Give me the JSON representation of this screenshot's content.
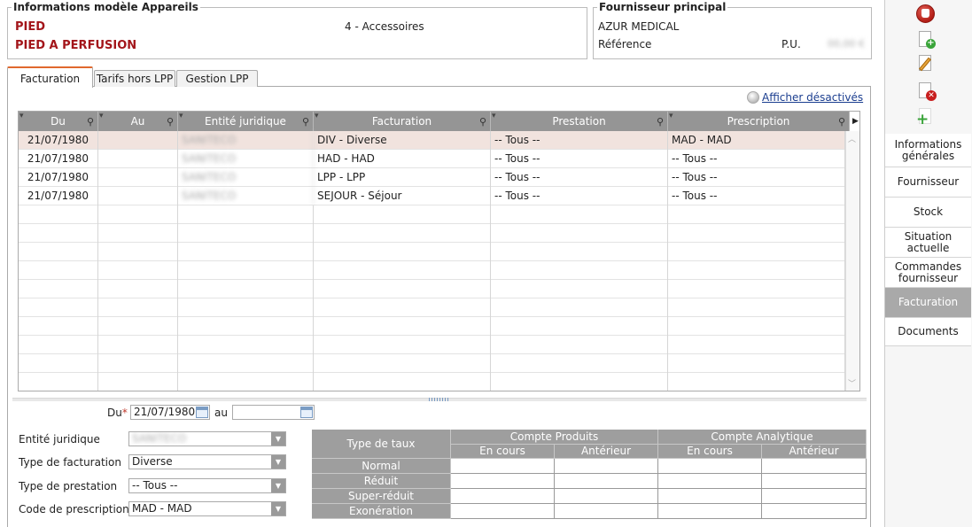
{
  "model_box": {
    "legend": "Informations modèle Appareils",
    "line1": "PIED",
    "line2": "PIED A PERFUSION",
    "category": "4 - Accessoires"
  },
  "supplier_box": {
    "legend": "Fournisseur principal",
    "name": "AZUR MEDICAL",
    "reference_label": "Référence",
    "pu_label": "P.U.",
    "pu_value": "00,00 €"
  },
  "tabs": [
    {
      "label": "Facturation",
      "active": true
    },
    {
      "label": "Tarifs hors LPP",
      "active": false
    },
    {
      "label": "Gestion LPP",
      "active": false
    }
  ],
  "show_disabled_link": "Afficher désactivés",
  "grid": {
    "columns": [
      "Du",
      "Au",
      "Entité juridique",
      "Facturation",
      "Prestation",
      "Prescription"
    ],
    "rows": [
      {
        "du": "21/07/1980",
        "au": "",
        "entite": "SANITECO",
        "facturation": "DIV - Diverse",
        "prestation": "-- Tous --",
        "prescription": "MAD - MAD"
      },
      {
        "du": "21/07/1980",
        "au": "",
        "entite": "SANITECO",
        "facturation": "HAD - HAD",
        "prestation": "-- Tous --",
        "prescription": "-- Tous --"
      },
      {
        "du": "21/07/1980",
        "au": "",
        "entite": "SANITECO",
        "facturation": "LPP - LPP",
        "prestation": "-- Tous --",
        "prescription": "-- Tous --"
      },
      {
        "du": "21/07/1980",
        "au": "",
        "entite": "SANITECO",
        "facturation": "SEJOUR - Séjour",
        "prestation": "-- Tous --",
        "prescription": "-- Tous --"
      }
    ]
  },
  "form": {
    "du_label": "Du",
    "required_mark": "*",
    "du_value": "21/07/1980",
    "au_label": "au",
    "au_value": "",
    "entite_label": "Entité juridique",
    "entite_value": "SANITECO",
    "type_fact_label": "Type de facturation",
    "type_fact_value": "Diverse",
    "type_prest_label": "Type de prestation",
    "type_prest_value": "-- Tous --",
    "code_presc_label": "Code de prescription",
    "code_presc_value": "MAD - MAD"
  },
  "rates": {
    "type_header": "Type de taux",
    "group1": "Compte Produits",
    "group2": "Compte Analytique",
    "sub": [
      "En cours",
      "Antérieur",
      "En cours",
      "Antérieur"
    ],
    "rows": [
      "Normal",
      "Réduit",
      "Super-réduit",
      "Exonération"
    ]
  },
  "side_menu": [
    {
      "label": "Informations générales",
      "active": false
    },
    {
      "label": "Fournisseur",
      "active": false
    },
    {
      "label": "Stock",
      "active": false
    },
    {
      "label": "Situation actuelle",
      "active": false
    },
    {
      "label": "Commandes fournisseur",
      "active": false
    },
    {
      "label": "Facturation",
      "active": true
    },
    {
      "label": "Documents",
      "active": false
    }
  ],
  "toolbar_icons": [
    "stop-hand-icon",
    "new-document-icon",
    "edit-document-icon",
    "delete-document-icon",
    "add-icon"
  ],
  "colors": {
    "accent_red": "#a3151a",
    "header_gray": "#959595",
    "tab_accent": "#e0682e",
    "selected_row": "#f1e3de",
    "link_blue": "#1a3d8f"
  }
}
